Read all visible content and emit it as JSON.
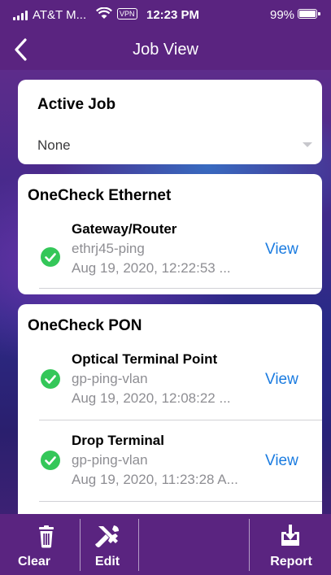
{
  "status_bar": {
    "carrier": "AT&T M...",
    "vpn": "VPN",
    "time": "12:23 PM",
    "battery": "99%"
  },
  "nav": {
    "title": "Job View",
    "back_icon": "chevron-left-icon"
  },
  "active_job": {
    "title": "Active Job",
    "value": "None"
  },
  "sections": [
    {
      "title": "OneCheck Ethernet",
      "items": [
        {
          "name": "Gateway/Router",
          "test": "ethrj45-ping",
          "time": "Aug 19, 2020, 12:22:53 ...",
          "action": "View"
        }
      ]
    },
    {
      "title": "OneCheck PON",
      "items": [
        {
          "name": "Optical Terminal Point",
          "test": "gp-ping-vlan",
          "time": "Aug 19, 2020, 12:08:22 ...",
          "action": "View"
        },
        {
          "name": "Drop Terminal",
          "test": "gp-ping-vlan",
          "time": "Aug 19, 2020, 11:23:28 A...",
          "action": "View"
        }
      ]
    }
  ],
  "toolbar": {
    "clear": "Clear",
    "edit": "Edit",
    "report": "Report"
  },
  "colors": {
    "accent": "#1a7be0",
    "success": "#34c759",
    "bar": "#5a2480"
  }
}
